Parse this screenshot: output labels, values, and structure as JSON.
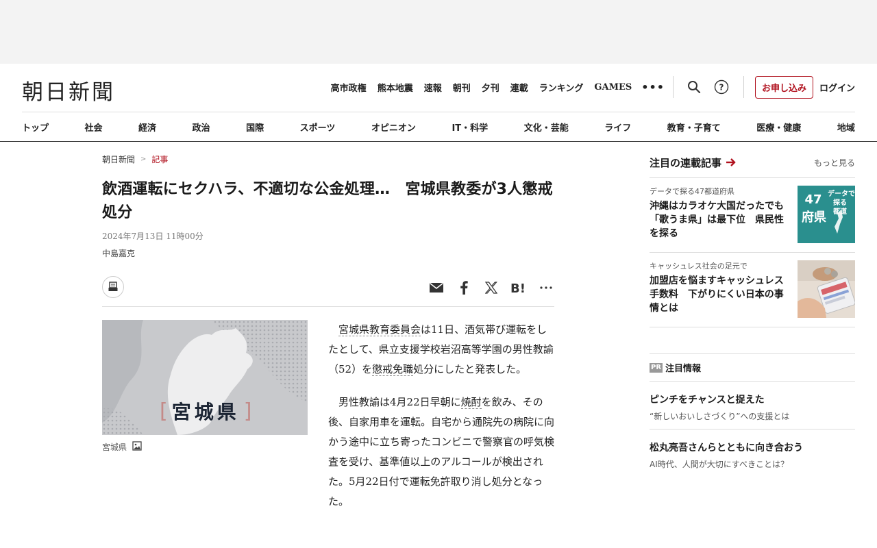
{
  "header": {
    "logo": "朝日新聞",
    "top_nav": [
      "高市政権",
      "熊本地震",
      "速報",
      "朝刊",
      "夕刊",
      "連載",
      "ランキング",
      "GAMES"
    ],
    "more": "•••",
    "apply_label": "お申し込み",
    "login_label": "ログイン",
    "categories": [
      "トップ",
      "社会",
      "経済",
      "政治",
      "国際",
      "スポーツ",
      "オピニオン",
      "IT・科学",
      "文化・芸能",
      "ライフ",
      "教育・子育て",
      "医療・健康",
      "地域"
    ]
  },
  "article": {
    "breadcrumb": [
      "朝日新聞",
      "記事"
    ],
    "breadcrumb_sep": ">",
    "headline": "飲酒運転にセクハラ、不適切な公金処理…　宮城県教委が3人懲戒処分",
    "date": "2024年7月13日 11時00分",
    "author": "中島嘉克",
    "figure": {
      "map_label": "宮城県",
      "bracket_left": "[",
      "bracket_right": "]",
      "caption": "宮城県"
    },
    "paragraph1": {
      "link1": "宮城県教育委員会",
      "text1": "は11日、酒気帯び運転をしたとして、県立支援学校岩沼高等学園の男性教諭（52）を",
      "link2": "懲戒免職",
      "text2": "処分にしたと発表した。"
    },
    "paragraph2": {
      "text1": "男性教諭は4月22日早朝に",
      "link1": "焼酎",
      "text2": "を飲み、その後、自家用車を運転。自宅から通院先の病院に向かう途中に立ち寄ったコンビニで警察官の呼気検査を受け、基準値以上のアルコールが検出された。5月22日付で運転免許取り消し処分となった。"
    }
  },
  "sidebar": {
    "title": "注目の連載記事",
    "more": "もっと見る",
    "cards": [
      {
        "kicker": "データで探る47都道府県",
        "title": "沖縄はカラオケ大国だったでも「歌うま県」は最下位　県民性を探る",
        "thumb_text_left": "47\n府県",
        "thumb_text_right": "データで\n探る\n都道"
      },
      {
        "kicker": "キャッシュレス社会の足元で",
        "title": "加盟店を悩ますキャッシュレス手数料　下がりにくい日本の事情とは"
      }
    ],
    "pr": {
      "badge": "PR",
      "title": "注目情報",
      "items": [
        {
          "title": "ピンチをチャンスと捉えた",
          "sub": "“新しいおいしさづくり”への支援とは"
        },
        {
          "title": "松丸亮吾さんらとともに向き合おう",
          "sub": "AI時代、人間が大切にすべきことは？"
        }
      ]
    }
  },
  "colors": {
    "accent": "#b0101d",
    "thumb_teal": "#2a8f8e"
  }
}
